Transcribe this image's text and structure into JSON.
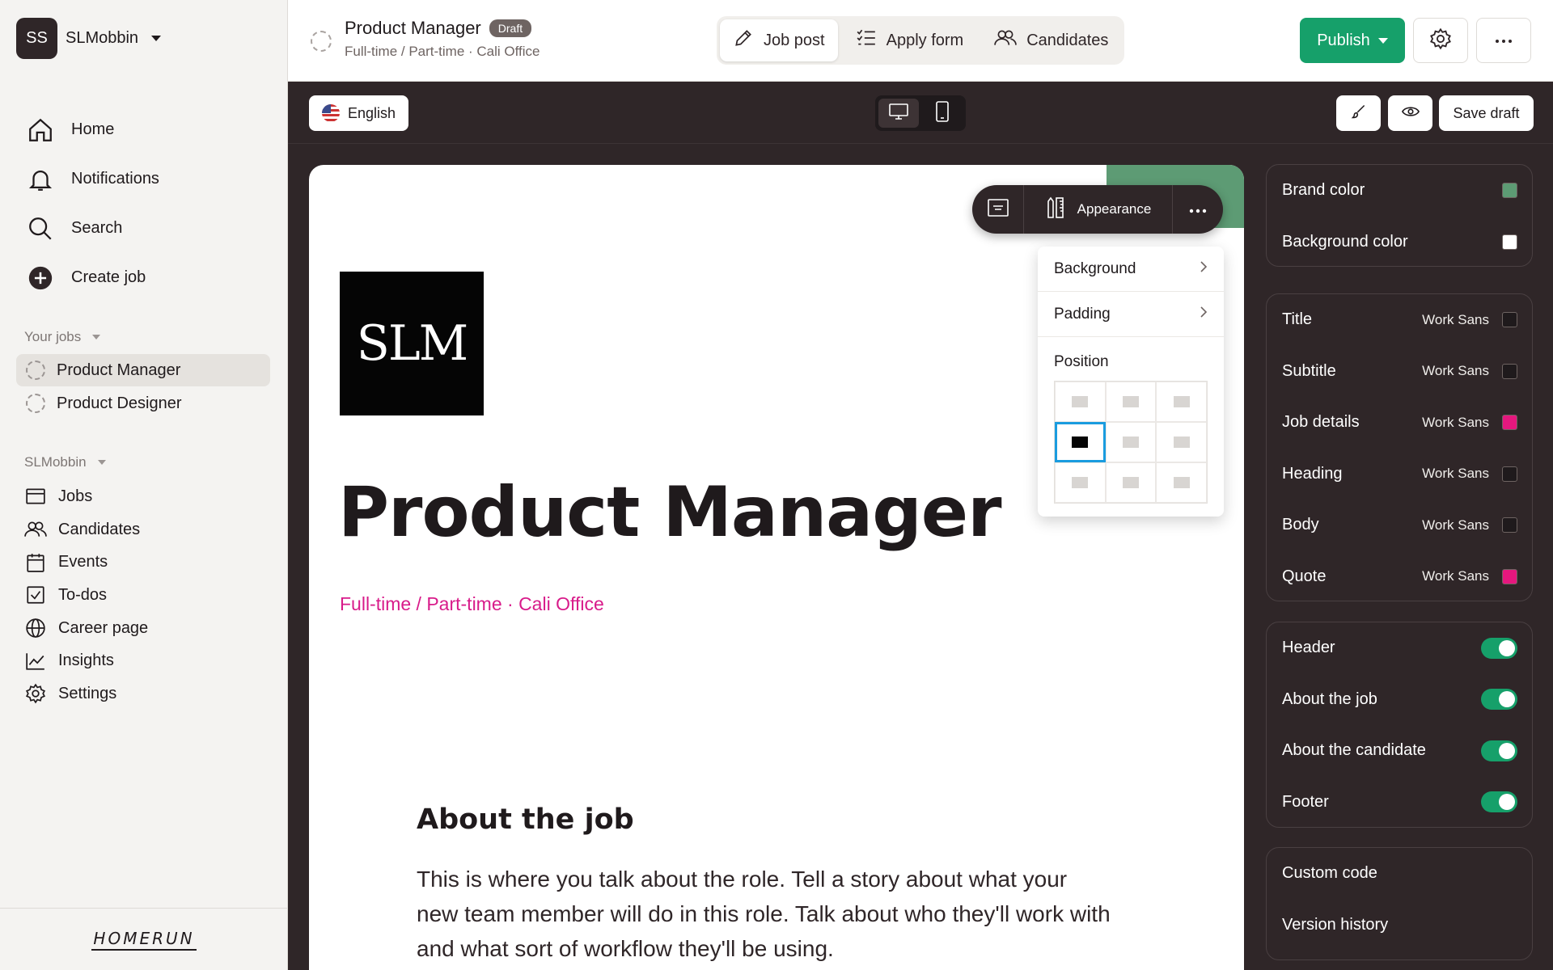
{
  "workspace": {
    "initials": "SS",
    "name": "SLMobbin"
  },
  "main_nav": [
    {
      "label": "Home",
      "icon": "home-icon"
    },
    {
      "label": "Notifications",
      "icon": "bell-icon"
    },
    {
      "label": "Search",
      "icon": "search-icon"
    },
    {
      "label": "Create job",
      "icon": "plus-circle-icon"
    }
  ],
  "your_jobs": {
    "label": "Your jobs",
    "items": [
      {
        "label": "Product Manager",
        "active": true
      },
      {
        "label": "Product Designer",
        "active": false
      }
    ]
  },
  "org": {
    "label": "SLMobbin",
    "items": [
      {
        "label": "Jobs",
        "icon": "briefcase-icon"
      },
      {
        "label": "Candidates",
        "icon": "users-icon"
      },
      {
        "label": "Events",
        "icon": "calendar-icon"
      },
      {
        "label": "To-dos",
        "icon": "checkbox-icon"
      },
      {
        "label": "Career page",
        "icon": "globe-icon"
      },
      {
        "label": "Insights",
        "icon": "chart-icon"
      },
      {
        "label": "Settings",
        "icon": "gear-icon"
      }
    ]
  },
  "brand": "HOMERUN",
  "header": {
    "title": "Product Manager",
    "badge": "Draft",
    "meta": "Full-time / Part-time · Cali Office",
    "tabs": [
      {
        "label": "Job post",
        "icon": "pencil-icon",
        "active": true
      },
      {
        "label": "Apply form",
        "icon": "checklist-icon",
        "active": false
      },
      {
        "label": "Candidates",
        "icon": "users-icon",
        "active": false
      }
    ],
    "publish_label": "Publish"
  },
  "editor_bar": {
    "language": "English",
    "save_draft": "Save draft"
  },
  "canvas": {
    "logo_text": "SLM",
    "heading": "Product Manager",
    "subheading": "Full-time / Part-time · Cali Office",
    "about_heading": "About the job",
    "about_text": "This is where you talk about the role. Tell a story about what your new team member will do in this role. Talk about who they'll work with and what sort of workflow they'll be using."
  },
  "floating_toolbar": {
    "appearance_label": "Appearance"
  },
  "popover": {
    "background_label": "Background",
    "padding_label": "Padding",
    "position_label": "Position",
    "selected_position": "middle-left"
  },
  "colors_card": {
    "rows": [
      {
        "label": "Brand color",
        "color": "#5d9b74"
      },
      {
        "label": "Background color",
        "color": "#ffffff"
      }
    ]
  },
  "typography_card": {
    "rows": [
      {
        "label": "Title",
        "font": "Work Sans",
        "color": "#1f1a1c"
      },
      {
        "label": "Subtitle",
        "font": "Work Sans",
        "color": "#1f1a1c"
      },
      {
        "label": "Job details",
        "font": "Work Sans",
        "color": "#e5177e"
      },
      {
        "label": "Heading",
        "font": "Work Sans",
        "color": "#1f1a1c"
      },
      {
        "label": "Body",
        "font": "Work Sans",
        "color": "#1f1a1c"
      },
      {
        "label": "Quote",
        "font": "Work Sans",
        "color": "#e5177e"
      }
    ]
  },
  "sections_card": {
    "rows": [
      {
        "label": "Header",
        "on": true
      },
      {
        "label": "About the job",
        "on": true
      },
      {
        "label": "About the candidate",
        "on": true
      },
      {
        "label": "Footer",
        "on": true
      }
    ]
  },
  "advanced_card": {
    "rows": [
      {
        "label": "Custom code"
      },
      {
        "label": "Version history"
      }
    ]
  },
  "accent_colors": {
    "publish": "#16a06a",
    "editor_bg": "#2f2628",
    "selection": "#1a9cdf",
    "job_details": "#d81b8a"
  }
}
